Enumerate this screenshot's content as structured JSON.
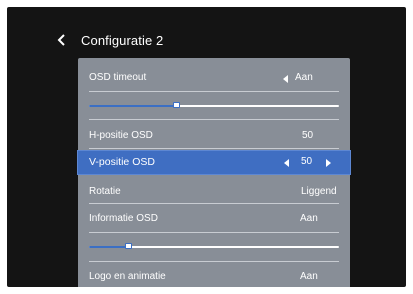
{
  "header": {
    "title": "Configuratie 2",
    "back_icon": "chevron-left-icon"
  },
  "settings": {
    "osd_timeout": {
      "label": "OSD timeout",
      "value": "Aan",
      "slider_fraction": 0.35
    },
    "h_positie": {
      "label": "H-positie OSD",
      "value": "50"
    },
    "v_positie": {
      "label": "V-positie OSD",
      "value": "50",
      "selected": true
    },
    "rotatie": {
      "label": "Rotatie",
      "value": "Liggend"
    },
    "informatie": {
      "label": "Informatie OSD",
      "value": "Aan",
      "slider_fraction": 0.16
    },
    "logo": {
      "label": "Logo en animatie",
      "value": "Aan"
    }
  },
  "colors": {
    "screen_bg": "#141414",
    "panel_bg": "#888e97",
    "selected_bg": "#3f6ec2",
    "text": "#ffffff"
  }
}
